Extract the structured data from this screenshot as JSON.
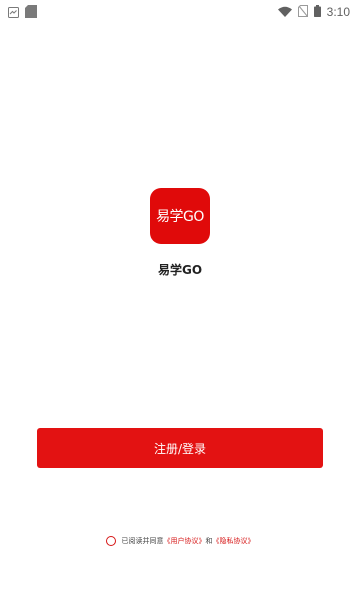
{
  "status_bar": {
    "time": "3:10",
    "icons": [
      "screenshot-icon",
      "sd-card-icon",
      "wifi-icon",
      "no-sim-icon",
      "battery-icon"
    ]
  },
  "logo": {
    "text": "易学GO",
    "color": "#e00a0a"
  },
  "app_name": "易学GO",
  "register_button": {
    "label": "注册/登录",
    "color": "#e31212"
  },
  "agreement": {
    "prefix": "已阅读并同意",
    "user_agreement": "《用户协议》",
    "conjunction": "和",
    "privacy_policy": "《隐私协议》",
    "checked": false
  }
}
